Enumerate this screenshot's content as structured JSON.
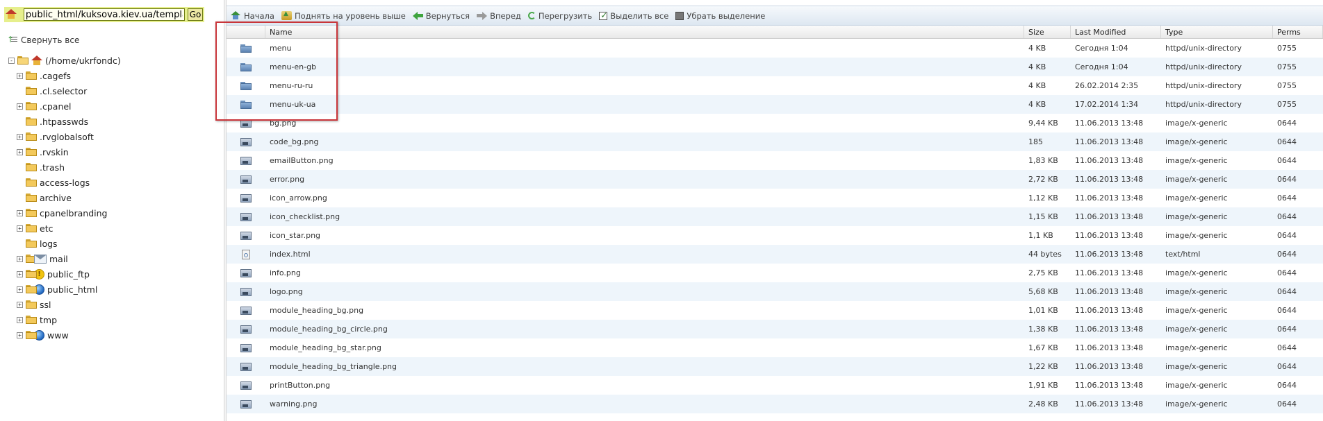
{
  "left": {
    "path_value": "public_html/kuksova.kiev.ua/templates/",
    "go_label": "Go",
    "collapse_label": "Свернуть все",
    "tree": [
      {
        "label": "(/home/ukrfondc)",
        "expander": "-",
        "kind": "root"
      },
      {
        "label": ".cagefs",
        "expander": "+",
        "kind": "folder"
      },
      {
        "label": ".cl.selector",
        "expander": "",
        "kind": "folder"
      },
      {
        "label": ".cpanel",
        "expander": "+",
        "kind": "folder"
      },
      {
        "label": ".htpasswds",
        "expander": "",
        "kind": "folder"
      },
      {
        "label": ".rvglobalsoft",
        "expander": "+",
        "kind": "folder"
      },
      {
        "label": ".rvskin",
        "expander": "+",
        "kind": "folder"
      },
      {
        "label": ".trash",
        "expander": "",
        "kind": "folder"
      },
      {
        "label": "access-logs",
        "expander": "",
        "kind": "folder"
      },
      {
        "label": "archive",
        "expander": "",
        "kind": "folder"
      },
      {
        "label": "cpanelbranding",
        "expander": "+",
        "kind": "folder"
      },
      {
        "label": "etc",
        "expander": "+",
        "kind": "folder"
      },
      {
        "label": "logs",
        "expander": "",
        "kind": "folder"
      },
      {
        "label": "mail",
        "expander": "+",
        "kind": "mail"
      },
      {
        "label": "public_ftp",
        "expander": "+",
        "kind": "ftp"
      },
      {
        "label": "public_html",
        "expander": "+",
        "kind": "web"
      },
      {
        "label": "ssl",
        "expander": "+",
        "kind": "folder"
      },
      {
        "label": "tmp",
        "expander": "+",
        "kind": "folder"
      },
      {
        "label": "www",
        "expander": "+",
        "kind": "web"
      }
    ]
  },
  "toolbar": {
    "home": "Начала",
    "up": "Поднять на уровень выше",
    "back": "Вернуться",
    "forward": "Вперед",
    "reload": "Перегрузить",
    "select_all": "Выделить все",
    "deselect": "Убрать выделение"
  },
  "table": {
    "headers": {
      "name": "Name",
      "size": "Size",
      "modified": "Last Modified",
      "type": "Type",
      "perms": "Perms"
    },
    "rows": [
      {
        "kind": "dir",
        "name": "menu",
        "size": "4 KB",
        "modified": "Сегодня 1:04",
        "type": "httpd/unix-directory",
        "perms": "0755"
      },
      {
        "kind": "dir",
        "name": "menu-en-gb",
        "size": "4 KB",
        "modified": "Сегодня 1:04",
        "type": "httpd/unix-directory",
        "perms": "0755"
      },
      {
        "kind": "dir",
        "name": "menu-ru-ru",
        "size": "4 KB",
        "modified": "26.02.2014 2:35",
        "type": "httpd/unix-directory",
        "perms": "0755"
      },
      {
        "kind": "dir",
        "name": "menu-uk-ua",
        "size": "4 KB",
        "modified": "17.02.2014 1:34",
        "type": "httpd/unix-directory",
        "perms": "0755"
      },
      {
        "kind": "img",
        "name": "bg.png",
        "size": "9,44 KB",
        "modified": "11.06.2013 13:48",
        "type": "image/x-generic",
        "perms": "0644"
      },
      {
        "kind": "img",
        "name": "code_bg.png",
        "size": "185",
        "modified": "11.06.2013 13:48",
        "type": "image/x-generic",
        "perms": "0644"
      },
      {
        "kind": "img",
        "name": "emailButton.png",
        "size": "1,83 KB",
        "modified": "11.06.2013 13:48",
        "type": "image/x-generic",
        "perms": "0644"
      },
      {
        "kind": "img",
        "name": "error.png",
        "size": "2,72 KB",
        "modified": "11.06.2013 13:48",
        "type": "image/x-generic",
        "perms": "0644"
      },
      {
        "kind": "img",
        "name": "icon_arrow.png",
        "size": "1,12 KB",
        "modified": "11.06.2013 13:48",
        "type": "image/x-generic",
        "perms": "0644"
      },
      {
        "kind": "img",
        "name": "icon_checklist.png",
        "size": "1,15 KB",
        "modified": "11.06.2013 13:48",
        "type": "image/x-generic",
        "perms": "0644"
      },
      {
        "kind": "img",
        "name": "icon_star.png",
        "size": "1,1 KB",
        "modified": "11.06.2013 13:48",
        "type": "image/x-generic",
        "perms": "0644"
      },
      {
        "kind": "html",
        "name": "index.html",
        "size": "44 bytes",
        "modified": "11.06.2013 13:48",
        "type": "text/html",
        "perms": "0644"
      },
      {
        "kind": "img",
        "name": "info.png",
        "size": "2,75 KB",
        "modified": "11.06.2013 13:48",
        "type": "image/x-generic",
        "perms": "0644"
      },
      {
        "kind": "img",
        "name": "logo.png",
        "size": "5,68 KB",
        "modified": "11.06.2013 13:48",
        "type": "image/x-generic",
        "perms": "0644"
      },
      {
        "kind": "img",
        "name": "module_heading_bg.png",
        "size": "1,01 KB",
        "modified": "11.06.2013 13:48",
        "type": "image/x-generic",
        "perms": "0644"
      },
      {
        "kind": "img",
        "name": "module_heading_bg_circle.png",
        "size": "1,38 KB",
        "modified": "11.06.2013 13:48",
        "type": "image/x-generic",
        "perms": "0644"
      },
      {
        "kind": "img",
        "name": "module_heading_bg_star.png",
        "size": "1,67 KB",
        "modified": "11.06.2013 13:48",
        "type": "image/x-generic",
        "perms": "0644"
      },
      {
        "kind": "img",
        "name": "module_heading_bg_triangle.png",
        "size": "1,22 KB",
        "modified": "11.06.2013 13:48",
        "type": "image/x-generic",
        "perms": "0644"
      },
      {
        "kind": "img",
        "name": "printButton.png",
        "size": "1,91 KB",
        "modified": "11.06.2013 13:48",
        "type": "image/x-generic",
        "perms": "0644"
      },
      {
        "kind": "img",
        "name": "warning.png",
        "size": "2,48 KB",
        "modified": "11.06.2013 13:48",
        "type": "image/x-generic",
        "perms": "0644"
      }
    ]
  },
  "colors": {
    "highlight_border": "#c9353a",
    "path_bar_bg": "#e6ef8c",
    "row_alt_bg": "#eef5fb"
  }
}
